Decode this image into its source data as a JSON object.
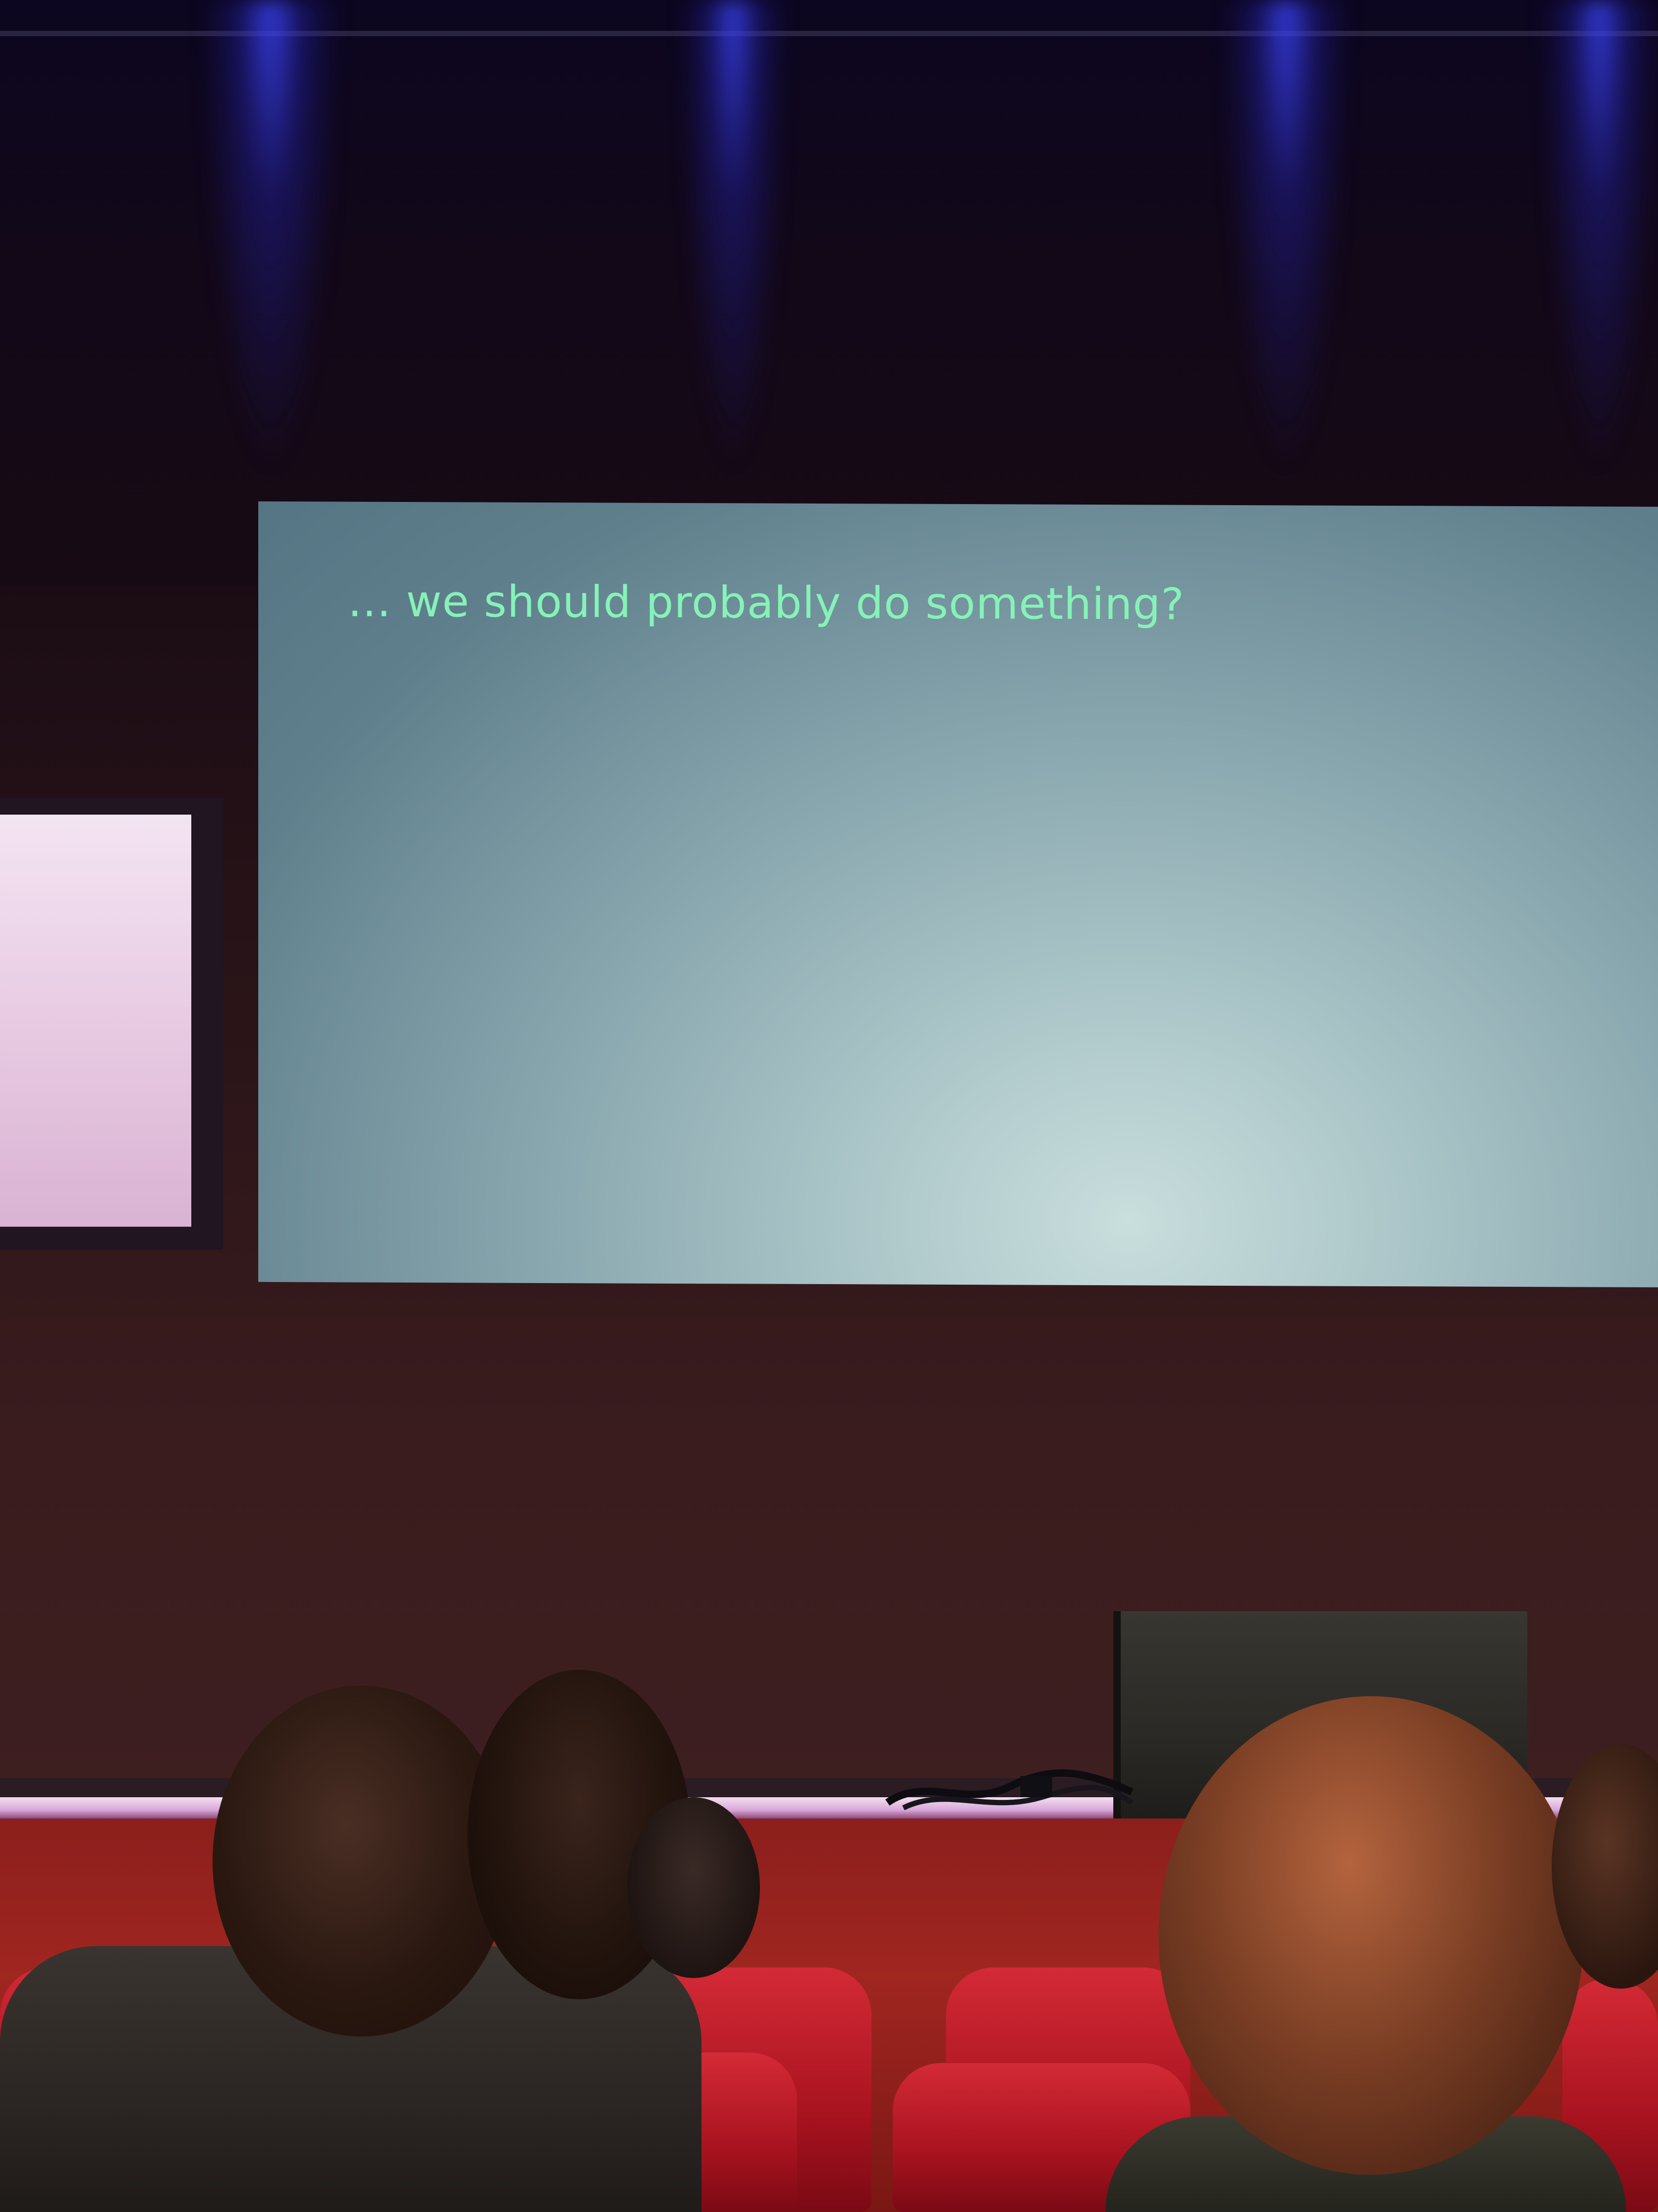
{
  "slide": {
    "text": "… we should probably do something?"
  },
  "colors": {
    "slide_text": "#86f2b8",
    "stage_light": "#3c46ff",
    "seat_red": "#c4202c"
  }
}
